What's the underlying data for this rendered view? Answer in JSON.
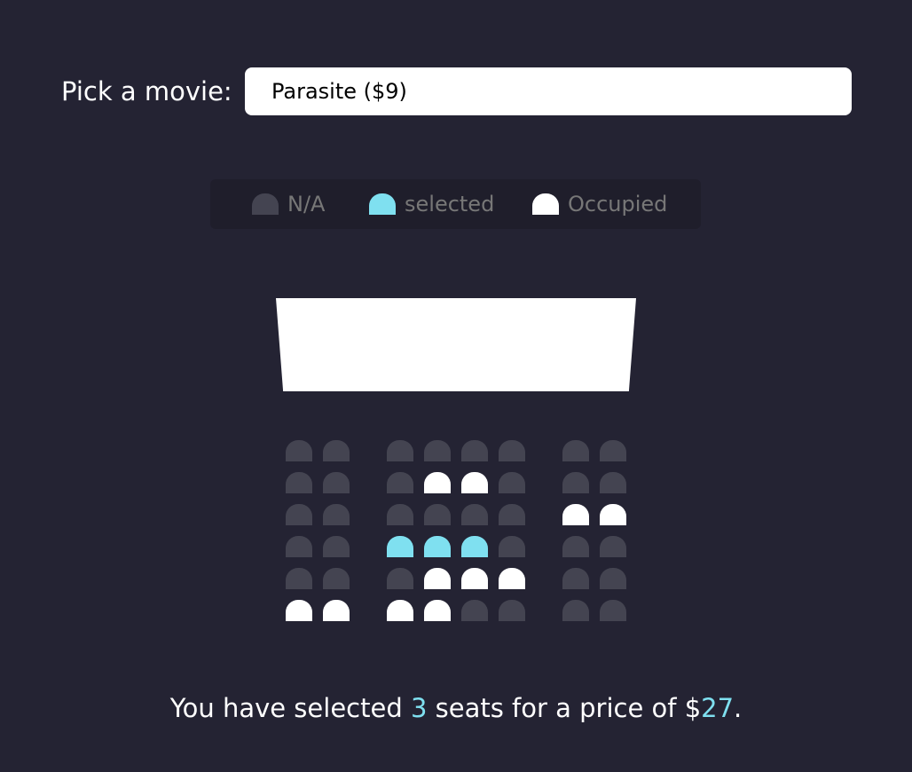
{
  "movie": {
    "label": "Pick a movie:",
    "selected": "Parasite ($9)"
  },
  "legend": [
    {
      "label": "N/A",
      "status": "na"
    },
    {
      "label": "selected",
      "status": "selected"
    },
    {
      "label": "Occupied",
      "status": "occupied"
    }
  ],
  "colors": {
    "background": "#242333",
    "seat_na": "#444451",
    "seat_selected": "#7fe0f0",
    "seat_occupied": "#ffffff",
    "accent": "#7fe0f0"
  },
  "seat_rows": [
    [
      "na",
      "na",
      "na",
      "na",
      "na",
      "na",
      "na",
      "na"
    ],
    [
      "na",
      "na",
      "na",
      "occupied",
      "occupied",
      "na",
      "na",
      "na"
    ],
    [
      "na",
      "na",
      "na",
      "na",
      "na",
      "na",
      "occupied",
      "occupied"
    ],
    [
      "na",
      "na",
      "selected",
      "selected",
      "selected",
      "na",
      "na",
      "na"
    ],
    [
      "na",
      "na",
      "na",
      "occupied",
      "occupied",
      "occupied",
      "na",
      "na"
    ],
    [
      "occupied",
      "occupied",
      "occupied",
      "occupied",
      "na",
      "na",
      "na",
      "na"
    ]
  ],
  "summary": {
    "prefix": "You have selected ",
    "count": "3",
    "middle": " seats for a price of $",
    "total": "27",
    "suffix": "."
  }
}
